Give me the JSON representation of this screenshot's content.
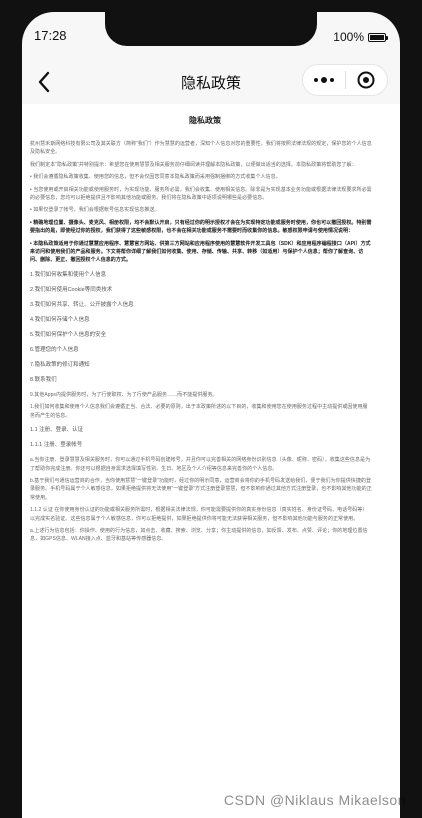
{
  "status_bar": {
    "time": "17:28",
    "battery_percent": "100%"
  },
  "navbar": {
    "title": "隐私政策",
    "back_icon": "chevron-left-icon",
    "more_icon": "more-dots-icon",
    "close_icon": "target-icon"
  },
  "document": {
    "heading": "隐私政策",
    "intro": [
      "杭州慧禾斯网络科技有限公司及其关联方（简称“我们”）作为慧慧的运营者，深知个人信息对您的重要性，我们将按照法律法规的规定，保护您的个人信息及隐私安全。",
      "我们制定本“隐私政策”并特别提示：希望您在使用慧慧及相关服务前仔细阅读并理解本隐私政策，以便做出适当的选择。本隐私政策将帮助您了解："
    ],
    "bullets": [
      "• 我们会遵循隐私政策收集、使用您的信息，但不会仅因您同意本隐私政策而采用强制捆绑的方式收集个人信息。",
      "• 当您使用或开启相关功能或使用服务时，为实现功能、服务所必需，我们会收集、使用相关信息。除非是为实现基本业务功能或根据法律法规要求所必需的必要信息，您均可以拒绝提供且不影响其他功能或服务。我们将在隐私政策中逐项说明哪些是必要信息。",
      "• 如果仅登录了帐号，我们会根据帐号信息实现信息推送。",
      "• 精确地理位置、摄像头、麦克风、相册权限，均不会默认开启，只有经过你的明示授权才会在为实现特定功能或服务时使用，你也可以撤回授权。特别需要指出的是，即使经过你的授权，我们获得了这些敏感权限，也不会在相关功能或服务不需要时而收集你的信息。敏感权限申请与使用情况说明：",
      "• 本隐私政策适用于你通过慧慧应用程序、慧慧官方网站、供第三方网站和应用程序使用的慧慧软件开发工具包（SDK）和应用程序编程接口（API）方式来访问和使用我们的产品和服务。下文将帮你详细了解我们如何收集、使用、存储、传输、共享、转移（如适用）与保护个人信息；帮你了解查询、访问、删除、更正、撤回授权个人信息的方式。"
    ],
    "toc": [
      "1.我们如何收集和使用个人信息",
      "2.我们如何使用Cookie等同类技术",
      "3.我们如何共享、转让、公开披露个人信息",
      "4.我们如何存储个人信息",
      "5.我们如何保护个人信息的安全",
      "6.管理您的个人信息",
      "7.隐私政策的修订和通知",
      "8.联系我们",
      "9.其他Apps内提供服务时，为了行使职权、为了行使产品服务……而不能提供服务。"
    ],
    "body": [
      "1.我们如何收集和使用个人信息我们会遵循正当、合法、必要的原则，出于本政策所述的以下目的，收集和使用您在使用服务过程中主动提供或因使用服务而产生的信息。",
      "1.1 注册、登录、认证",
      "1.1.1 注册、登录帐号",
      "a.当你注册、登录慧慧及相关服务时，你可以通过手机号码创建帐号，并且你可以完善相关的网络身份识别信息（头像、昵称、密码），收集这些信息是为了帮助你完成注册。你还可以根据自身需求选择填写性别、生日、地区及个人介绍等信息来完善你的个人信息。",
      "b.基于我们与通信运营商的合作，当你使用慧慧“一键登录”功能时，经过你的明示同意，运营商会将你的手机号码发送给我们，便于我们为你提供快捷的登录服务。手机号码属于个人敏感信息，如果拒绝提供将无法使用“一键登录”方式注册登录慧慧，但不影响你通过其他方式注册登录，也不影响其他功能的正常使用。",
      "1.1.2 认证 在你使用身份认证的功能或相关服务所需时，根据相关法律法规，你可能需要提供你的真实身份信息（真实姓名、身份证号码、电话号码等）以完成实名验证。这些信息属于个人敏感信息，你可以拒绝提供，如果拒绝提供你将可能无法获得相关服务，但不影响其他功能与服务的正常使用。",
      "a.上述行为信息包括：你操作、使用的行为信息，如点击、收藏、搜索、浏览、分享；你主动提供的信息，如反馈、发布、点赞、评论；你的地理位置信息，如GPS信息、WLAN接入点、蓝牙和基站等传感器信息。"
    ]
  },
  "watermark": "CSDN @Niklaus Mikaelson"
}
